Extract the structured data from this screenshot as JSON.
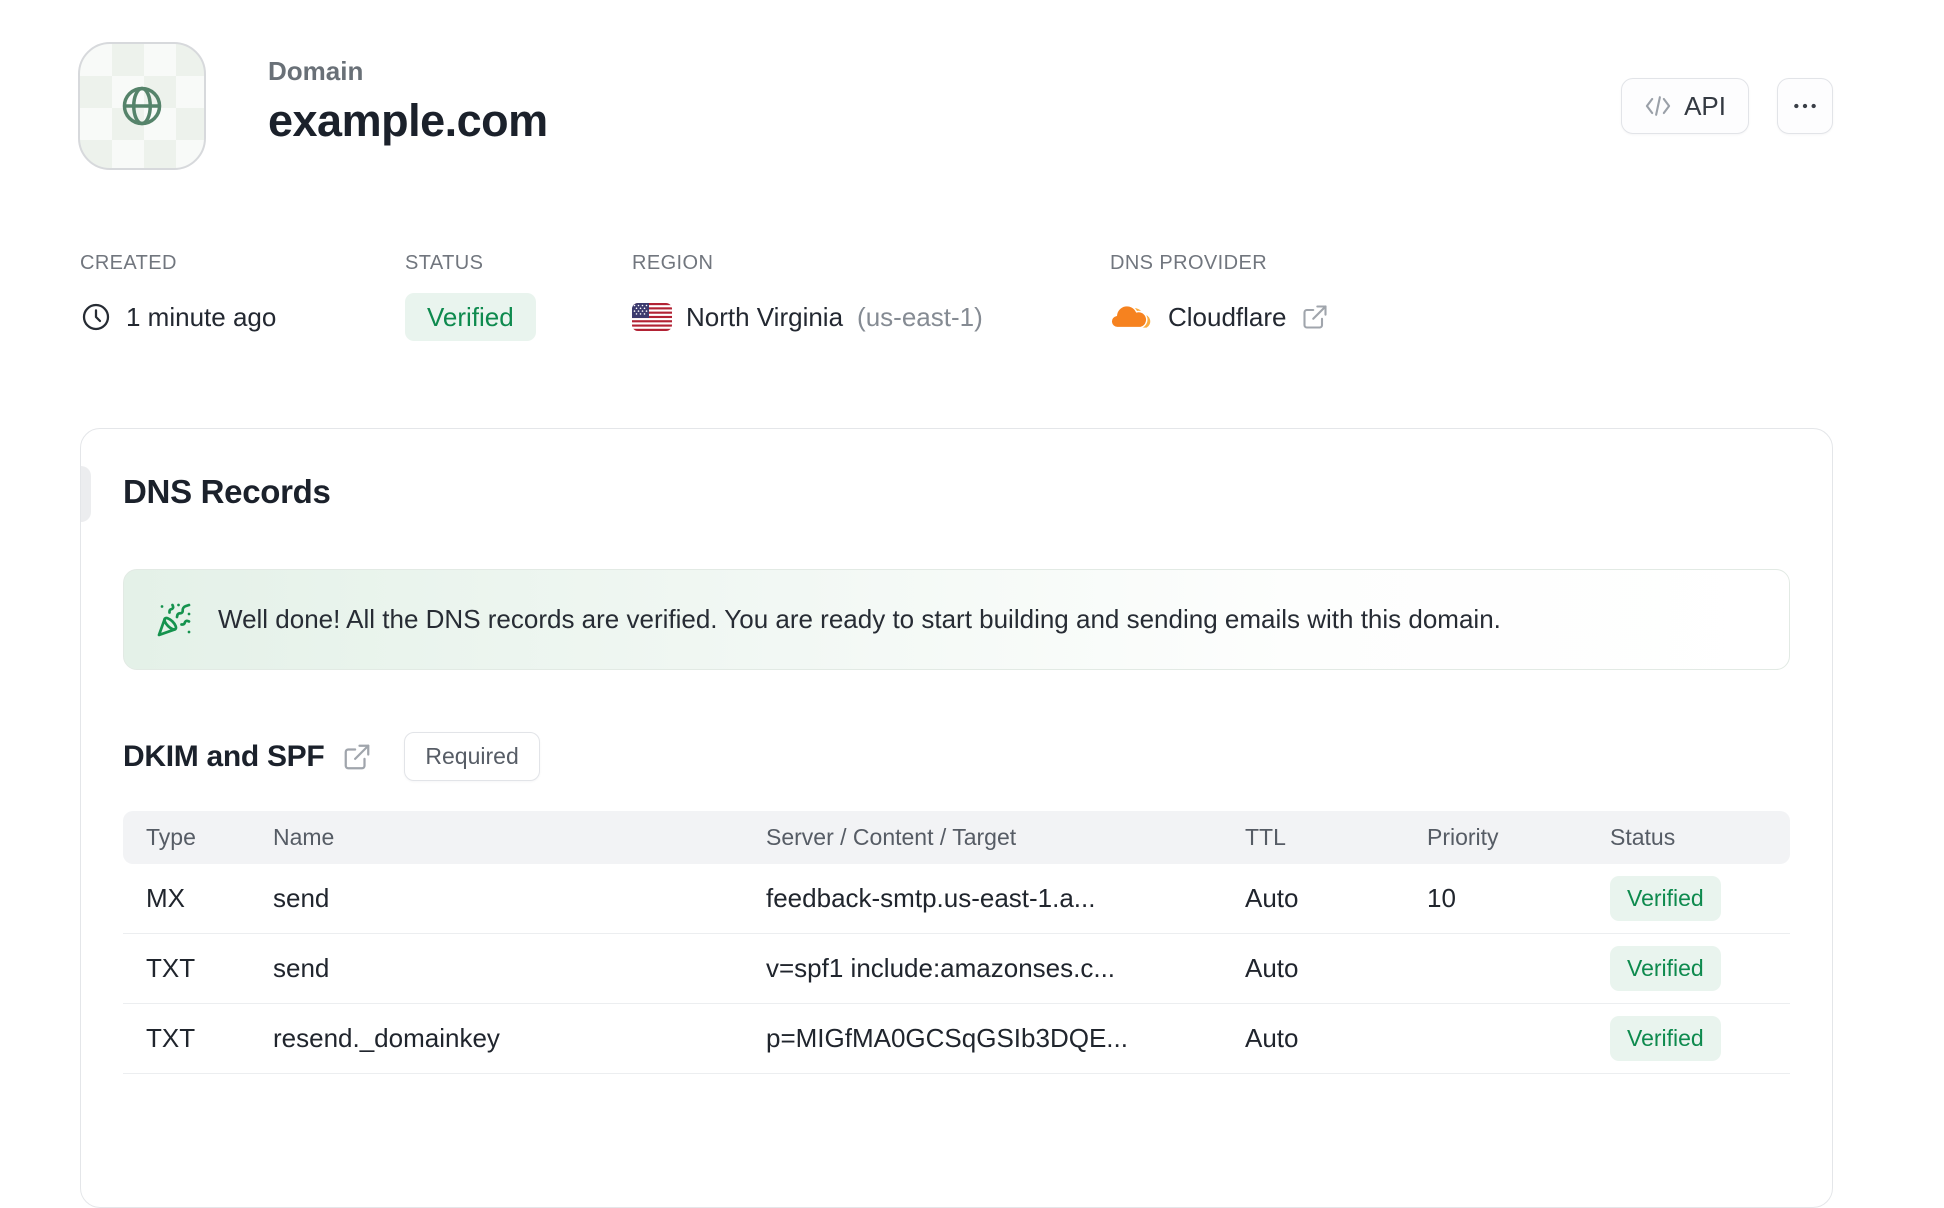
{
  "header": {
    "eyebrow": "Domain",
    "title": "example.com",
    "api_button_label": "API"
  },
  "meta": {
    "created": {
      "label": "CREATED",
      "value": "1 minute ago"
    },
    "status": {
      "label": "STATUS",
      "value": "Verified"
    },
    "region": {
      "label": "REGION",
      "value": "North Virginia",
      "code": "(us-east-1)"
    },
    "dns_provider": {
      "label": "DNS PROVIDER",
      "value": "Cloudflare"
    }
  },
  "dns_card": {
    "title": "DNS Records",
    "banner_text": "Well done! All the DNS records are verified. You are ready to start building and sending emails with this domain.",
    "section": {
      "title": "DKIM and SPF",
      "badge": "Required"
    },
    "table": {
      "headers": [
        "Type",
        "Name",
        "Server / Content / Target",
        "TTL",
        "Priority",
        "Status"
      ],
      "rows": [
        {
          "type": "MX",
          "name": "send",
          "content": "feedback-smtp.us-east-1.a...",
          "ttl": "Auto",
          "priority": "10",
          "status": "Verified"
        },
        {
          "type": "TXT",
          "name": "send",
          "content": "v=spf1 include:amazonses.c...",
          "ttl": "Auto",
          "priority": "",
          "status": "Verified"
        },
        {
          "type": "TXT",
          "name": "resend._domainkey",
          "content": "p=MIGfMA0GCSqGSIb3DQE...",
          "ttl": "Auto",
          "priority": "",
          "status": "Verified"
        }
      ]
    }
  },
  "icons": {
    "avatar": "globe-icon",
    "api": "code-icon",
    "more": "ellipsis-icon",
    "created": "clock-icon",
    "region": "us-flag-icon",
    "dns_provider": "cloudflare-icon",
    "external": "external-link-icon",
    "banner": "party-popper-icon"
  },
  "colors": {
    "accent_green_text": "#0e8a4e",
    "green_badge_bg": "#e9f4ee",
    "banner_green": "#e4f1e8",
    "cloudflare_orange": "#f6821f",
    "cloudflare_light_orange": "#fbad41",
    "globe_green": "#55836a",
    "border_gray": "#e4e6e9"
  }
}
